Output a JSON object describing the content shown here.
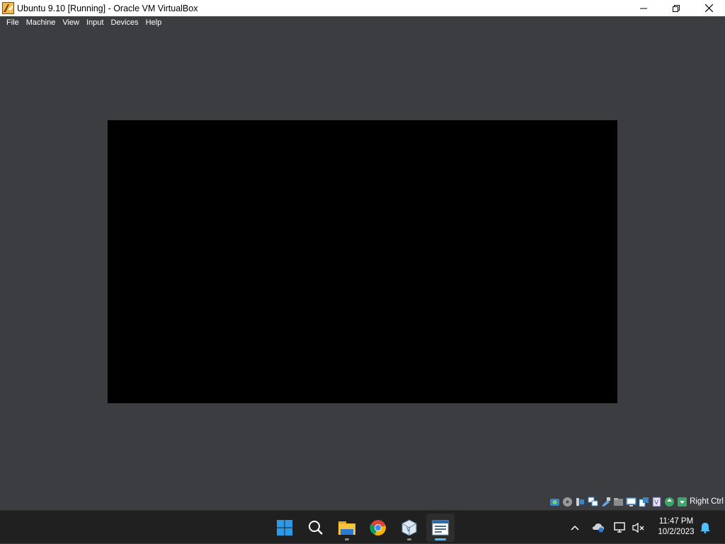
{
  "window": {
    "title": "Ubuntu 9.10 [Running] - Oracle VM VirtualBox",
    "controls": [
      "minimize-icon",
      "maximize-icon",
      "close-icon"
    ]
  },
  "menubar": {
    "items": [
      "File",
      "Machine",
      "View",
      "Input",
      "Devices",
      "Help"
    ]
  },
  "statusbar": {
    "icons": [
      "hard-disk-icon",
      "optical-drive-icon",
      "audio-icon",
      "network-icon",
      "usb-icon",
      "shared-folders-icon",
      "display-icon",
      "video-capture-icon",
      "virtualization-icon",
      "mouse-integration-icon",
      "keyboard-icon"
    ],
    "host_key": "Right Ctrl"
  },
  "taskbar": {
    "apps": [
      "windows-start-icon",
      "search-icon",
      "file-explorer-icon",
      "chrome-icon",
      "virtualbox-icon",
      "vm-window-icon"
    ],
    "tray_icons": [
      "chevron-up-icon",
      "onedrive-icon",
      "network-icon",
      "volume-muted-icon",
      "notification-bell-icon"
    ],
    "time": "11:47 PM",
    "date": "10/2/2023"
  },
  "colors": {
    "window_bg": "#3c3d40",
    "vm_screen": "#000000",
    "taskbar_bg": "#202020",
    "accent": "#4cc2ff"
  }
}
